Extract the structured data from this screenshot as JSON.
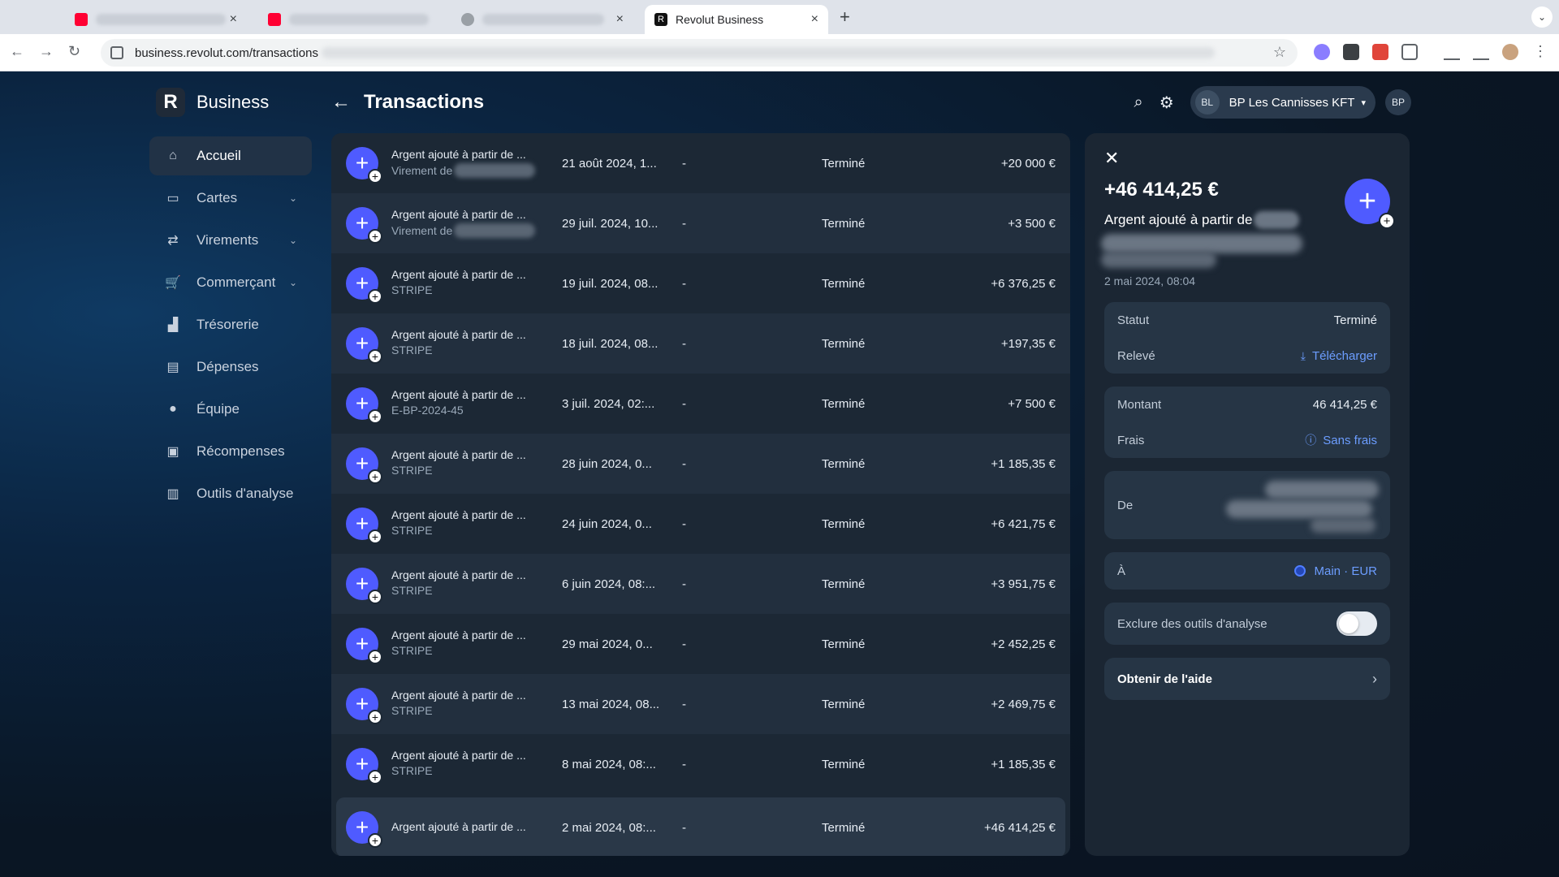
{
  "browser": {
    "tabs": [
      {
        "title": "",
        "close": "×"
      },
      {
        "title": "",
        "close": ""
      },
      {
        "title": "",
        "close": "×"
      },
      {
        "title": "Revolut Business",
        "close": "×"
      }
    ],
    "new_tab": "+",
    "url": "business.revolut.com/transactions",
    "menu_chev": "⌄"
  },
  "app": {
    "brand": "Business",
    "brand_logo": "R",
    "page_title": "Transactions",
    "account_initials": "BL",
    "account_name": "BP Les Cannisses KFT",
    "profile_initials": "BP"
  },
  "sidebar": {
    "items": [
      {
        "label": "Accueil",
        "icon": "home-icon",
        "chevron": ""
      },
      {
        "label": "Cartes",
        "icon": "card-icon",
        "chevron": "⌄"
      },
      {
        "label": "Virements",
        "icon": "transfer-icon",
        "chevron": "⌄"
      },
      {
        "label": "Commerçant",
        "icon": "cart-icon",
        "chevron": "⌄"
      },
      {
        "label": "Trésorerie",
        "icon": "chart-icon",
        "chevron": ""
      },
      {
        "label": "Dépenses",
        "icon": "receipt-icon",
        "chevron": ""
      },
      {
        "label": "Équipe",
        "icon": "team-icon",
        "chevron": ""
      },
      {
        "label": "Récompenses",
        "icon": "gift-icon",
        "chevron": ""
      },
      {
        "label": "Outils d'analyse",
        "icon": "analytics-icon",
        "chevron": ""
      }
    ]
  },
  "transactions": [
    {
      "title": "Argent ajouté à partir de ...",
      "subtitle": "Virement de",
      "date": "21 août 2024, 1...",
      "reference": "-",
      "status": "Terminé",
      "amount": "+20 000 €",
      "blurred": true
    },
    {
      "title": "Argent ajouté à partir de ...",
      "subtitle": "Virement de",
      "date": "29 juil. 2024, 10...",
      "reference": "-",
      "status": "Terminé",
      "amount": "+3 500 €",
      "blurred": true
    },
    {
      "title": "Argent ajouté à partir de ...",
      "subtitle": "STRIPE",
      "date": "19 juil. 2024, 08...",
      "reference": "-",
      "status": "Terminé",
      "amount": "+6 376,25 €",
      "blurred": false
    },
    {
      "title": "Argent ajouté à partir de ...",
      "subtitle": "STRIPE",
      "date": "18 juil. 2024, 08...",
      "reference": "-",
      "status": "Terminé",
      "amount": "+197,35 €",
      "blurred": false
    },
    {
      "title": "Argent ajouté à partir de ...",
      "subtitle": "E-BP-2024-45",
      "date": "3 juil. 2024, 02:...",
      "reference": "-",
      "status": "Terminé",
      "amount": "+7 500 €",
      "blurred": false
    },
    {
      "title": "Argent ajouté à partir de ...",
      "subtitle": "STRIPE",
      "date": "28 juin 2024, 0...",
      "reference": "-",
      "status": "Terminé",
      "amount": "+1 185,35 €",
      "blurred": false
    },
    {
      "title": "Argent ajouté à partir de ...",
      "subtitle": "STRIPE",
      "date": "24 juin 2024, 0...",
      "reference": "-",
      "status": "Terminé",
      "amount": "+6 421,75 €",
      "blurred": false
    },
    {
      "title": "Argent ajouté à partir de ...",
      "subtitle": "STRIPE",
      "date": "6 juin 2024, 08:...",
      "reference": "-",
      "status": "Terminé",
      "amount": "+3 951,75 €",
      "blurred": false
    },
    {
      "title": "Argent ajouté à partir de ...",
      "subtitle": "STRIPE",
      "date": "29 mai 2024, 0...",
      "reference": "-",
      "status": "Terminé",
      "amount": "+2 452,25 €",
      "blurred": false
    },
    {
      "title": "Argent ajouté à partir de ...",
      "subtitle": "STRIPE",
      "date": "13 mai 2024, 08...",
      "reference": "-",
      "status": "Terminé",
      "amount": "+2 469,75 €",
      "blurred": false
    },
    {
      "title": "Argent ajouté à partir de ...",
      "subtitle": "STRIPE",
      "date": "8 mai 2024, 08:...",
      "reference": "-",
      "status": "Terminé",
      "amount": "+1 185,35 €",
      "blurred": false
    },
    {
      "title": "Argent ajouté à partir de ...",
      "subtitle": "",
      "date": "2 mai 2024, 08:...",
      "reference": "-",
      "status": "Terminé",
      "amount": "+46 414,25 €",
      "blurred": false,
      "selected": true
    }
  ],
  "detail": {
    "amount": "+46 414,25 €",
    "title": "Argent ajouté à partir de",
    "date": "2 mai 2024, 08:04",
    "status_label": "Statut",
    "status_value": "Terminé",
    "statement_label": "Relevé",
    "download_label": "Télécharger",
    "amount_label": "Montant",
    "amount_value": "46 414,25 €",
    "fees_label": "Frais",
    "fees_value": "Sans frais",
    "from_label": "De",
    "to_label": "À",
    "to_value": "Main · EUR",
    "exclude_label": "Exclure des outils d'analyse",
    "exclude_enabled": false,
    "help_label": "Obtenir de l'aide"
  },
  "colors": {
    "accent": "#4f5bff",
    "link": "#6c9dff",
    "panel": "#1b2633"
  }
}
